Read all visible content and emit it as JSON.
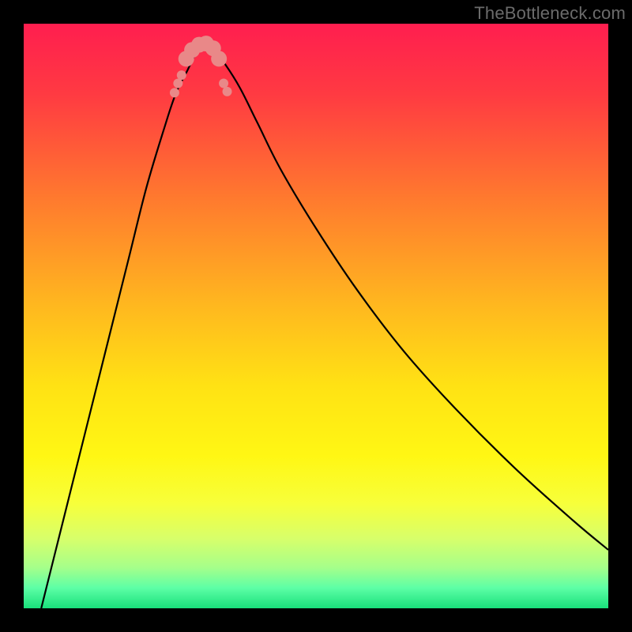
{
  "watermark": "TheBottleneck.com",
  "chart_data": {
    "type": "line",
    "title": "",
    "xlabel": "",
    "ylabel": "",
    "xlim": [
      0,
      100
    ],
    "ylim": [
      0,
      100
    ],
    "gradient_stops": [
      {
        "offset": 0.0,
        "color": "#ff1e4f"
      },
      {
        "offset": 0.12,
        "color": "#ff3a42"
      },
      {
        "offset": 0.3,
        "color": "#ff7a2e"
      },
      {
        "offset": 0.48,
        "color": "#ffb71f"
      },
      {
        "offset": 0.62,
        "color": "#ffe214"
      },
      {
        "offset": 0.74,
        "color": "#fff714"
      },
      {
        "offset": 0.82,
        "color": "#f7ff3a"
      },
      {
        "offset": 0.88,
        "color": "#d8ff6a"
      },
      {
        "offset": 0.93,
        "color": "#a6ff8a"
      },
      {
        "offset": 0.965,
        "color": "#5dffa6"
      },
      {
        "offset": 1.0,
        "color": "#19e07b"
      }
    ],
    "green_band": {
      "y0": 97.3,
      "y1": 100
    },
    "series": [
      {
        "name": "bottleneck-curve",
        "x": [
          3,
          6,
          9,
          12,
          15,
          18,
          21,
          24,
          26,
          28,
          29.5,
          31,
          32.5,
          34.5,
          37,
          40,
          44,
          50,
          57,
          65,
          74,
          84,
          94,
          100
        ],
        "y": [
          0,
          12,
          24,
          36,
          48,
          60,
          72,
          82,
          88,
          92,
          95,
          96.5,
          95.5,
          93,
          89,
          83,
          75,
          65,
          54.5,
          44,
          34,
          24,
          15,
          10
        ]
      }
    ],
    "markers": {
      "name": "highlight-dots",
      "color": "#e98888",
      "radius_small": 6,
      "radius_large": 10,
      "points": [
        {
          "x": 25.8,
          "y": 88.2,
          "r": "small"
        },
        {
          "x": 26.4,
          "y": 89.8,
          "r": "small"
        },
        {
          "x": 27.0,
          "y": 91.2,
          "r": "small"
        },
        {
          "x": 34.2,
          "y": 89.8,
          "r": "small"
        },
        {
          "x": 34.8,
          "y": 88.4,
          "r": "small"
        },
        {
          "x": 27.8,
          "y": 94.0,
          "r": "large"
        },
        {
          "x": 28.8,
          "y": 95.5,
          "r": "large"
        },
        {
          "x": 30.0,
          "y": 96.4,
          "r": "large"
        },
        {
          "x": 31.2,
          "y": 96.6,
          "r": "large"
        },
        {
          "x": 32.4,
          "y": 95.8,
          "r": "large"
        },
        {
          "x": 33.4,
          "y": 94.0,
          "r": "large"
        }
      ]
    }
  }
}
